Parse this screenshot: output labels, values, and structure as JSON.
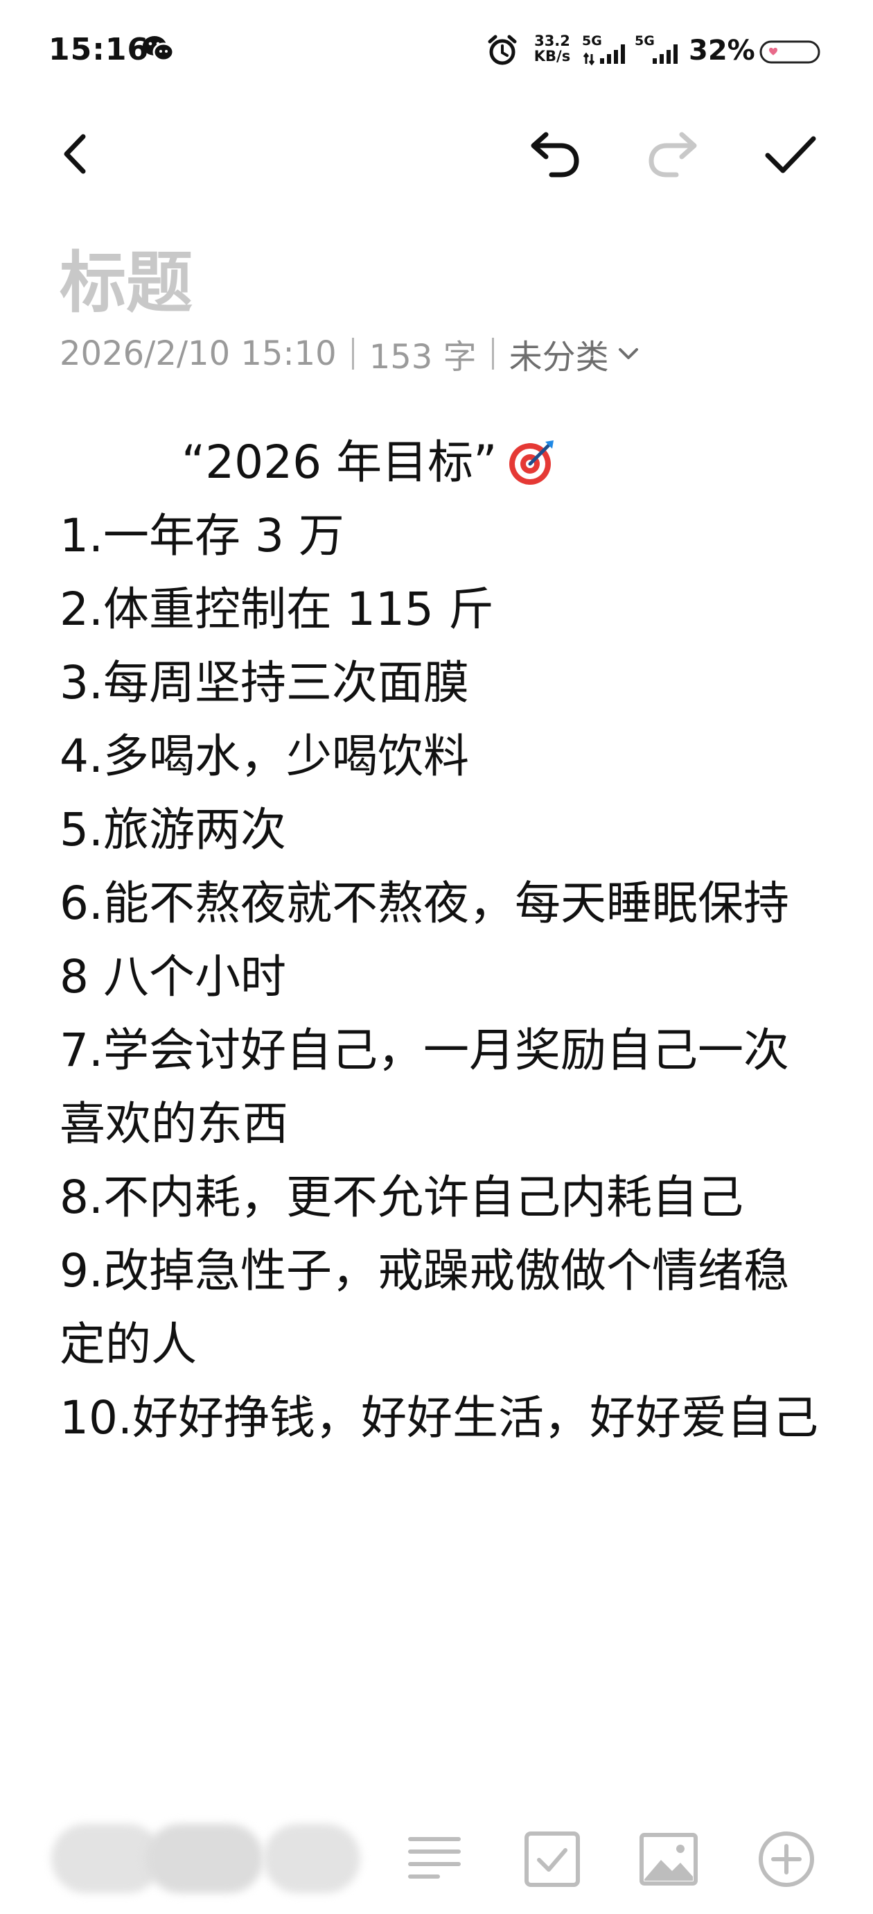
{
  "status_bar": {
    "time": "15:16",
    "net_speed_value": "33.2",
    "net_speed_unit": "KB/s",
    "signal_1_label": "5G",
    "signal_2_label": "5G",
    "battery": "32%",
    "icons": [
      "wechat-icon",
      "alarm-icon",
      "signal-icon",
      "battery-icon"
    ]
  },
  "toolbar": {
    "icons": [
      "back-icon",
      "undo-icon",
      "redo-icon",
      "check-icon"
    ],
    "redo_enabled": false
  },
  "note": {
    "title_placeholder": "标题",
    "date": "2026/2/10 15:10",
    "char_count": "153 字",
    "category": "未分类",
    "heading": "“2026 年目标”",
    "lines": [
      "1.一年存 3 万",
      "2.体重控制在 115 斤",
      "3.每周坚持三次面膜",
      "4.多喝水，少喝饮料",
      "5.旅游两次",
      "6.能不熬夜就不熬夜，每天睡眠保持 8 八个小时",
      "7.学会讨好自己，一月奖励自己一次喜欢的东西",
      "8.不内耗，更不允许自己内耗自己",
      "9.改掉急性子，戒躁戒傲做个情绪稳定的人",
      "10.好好挣钱，好好生活，好好爱自己"
    ]
  },
  "bottom_bar": {
    "icons": [
      "format-list-icon",
      "checkbox-icon",
      "image-icon",
      "add-circle-icon"
    ]
  },
  "colors": {
    "text": "#111111",
    "placeholder": "#c8c8c8",
    "meta": "#9a9a9a",
    "disabled_icon": "#c8c8c8",
    "bottom_icon": "#bdbdbd"
  }
}
